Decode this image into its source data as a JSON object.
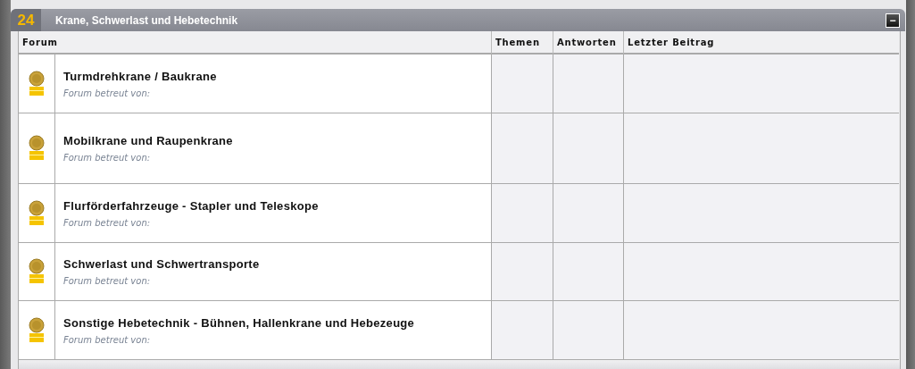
{
  "category": {
    "number": "24",
    "title": "Krane, Schwerlast und Hebetechnik",
    "collapse_symbol": "−"
  },
  "columns": [
    "Forum",
    "Themen",
    "Antworten",
    "Letzter Beitrag"
  ],
  "forums": [
    {
      "title": "Turmdrehkrane / Baukrane",
      "moderators": "Forum betreut von:"
    },
    {
      "title": "Mobilkrane und Raupenkrane",
      "moderators": "Forum betreut von:"
    },
    {
      "title": "Flurförderfahrzeuge - Stapler und Teleskope",
      "moderators": "Forum betreut von:"
    },
    {
      "title": "Schwerlast und Schwertransporte",
      "moderators": "Forum betreut von:"
    },
    {
      "title": "Sonstige Hebetechnik - Bühnen, Hallenkrane und Hebezeuge",
      "moderators": "Forum betreut von:"
    }
  ]
}
